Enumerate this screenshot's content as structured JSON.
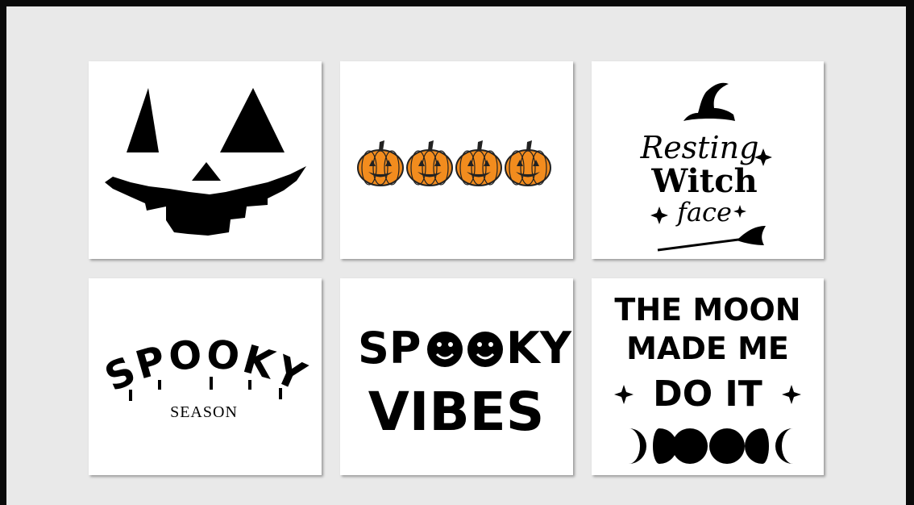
{
  "designs": [
    {
      "name": "jack-o-lantern-face"
    },
    {
      "name": "four-pumpkins",
      "pumpkin_color": "#f28c1e",
      "pumpkin_count": 4
    },
    {
      "name": "resting-witch-face",
      "line1": "Resting",
      "line2": "Witch",
      "line3": "face"
    },
    {
      "name": "spooky-season",
      "title": "SPOOKY",
      "subtitle": "SEASON"
    },
    {
      "name": "spooky-vibes",
      "line1": "SP",
      "line2": "KY",
      "line3": "VIBES"
    },
    {
      "name": "moon-made-me",
      "line1": "THE MOON",
      "line2": "MADE ME",
      "line3": "DO IT"
    }
  ],
  "colors": {
    "background": "#e9e9e9",
    "border": "#0a0a0a",
    "ink": "#000000",
    "pumpkin": "#f28c1e"
  }
}
